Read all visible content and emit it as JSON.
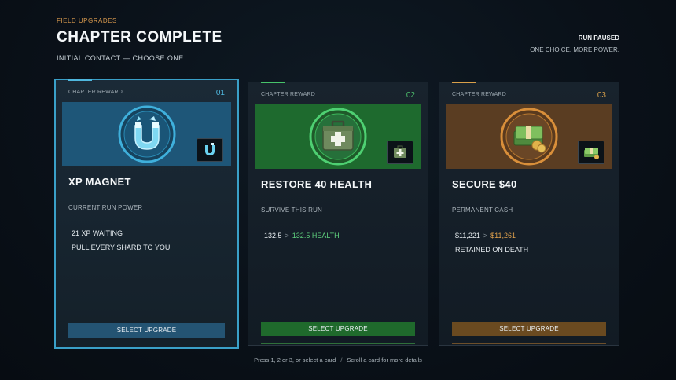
{
  "header": {
    "eyebrow": "FIELD UPGRADES",
    "title": "CHAPTER COMPLETE",
    "subtitle": "INITIAL CONTACT — CHOOSE ONE",
    "status_main": "RUN PAUSED",
    "status_sub": "ONE CHOICE. MORE POWER."
  },
  "cards": [
    {
      "tag": "CHAPTER REWARD",
      "number": "01",
      "icon": "magnet-icon",
      "title": "XP MAGNET",
      "description": "CURRENT RUN POWER",
      "line1": "21 XP WAITING",
      "line2": "PULL EVERY SHARD TO YOU",
      "button": "SELECT UPGRADE",
      "selected": true,
      "accent": "#3aa0c8"
    },
    {
      "tag": "CHAPTER REWARD",
      "number": "02",
      "icon": "medkit-icon",
      "title": "RESTORE 40 HEALTH",
      "description": "SURVIVE THIS RUN",
      "from": "132.5",
      "arrow": ">",
      "to": "132.5 HEALTH",
      "button": "SELECT UPGRADE",
      "accent": "#47c36a"
    },
    {
      "tag": "CHAPTER REWARD",
      "number": "03",
      "icon": "cash-icon",
      "title": "SECURE $40",
      "description": "PERMANENT CASH",
      "from": "$11,221",
      "arrow": ">",
      "to": "$11,261",
      "line2": "RETAINED ON DEATH",
      "button": "SELECT UPGRADE",
      "accent": "#d9a04a"
    }
  ],
  "footer": {
    "hint_keys": "Press 1, 2 or 3, or select a card",
    "separator": "/",
    "hint_scroll": "Scroll a card for more details"
  }
}
